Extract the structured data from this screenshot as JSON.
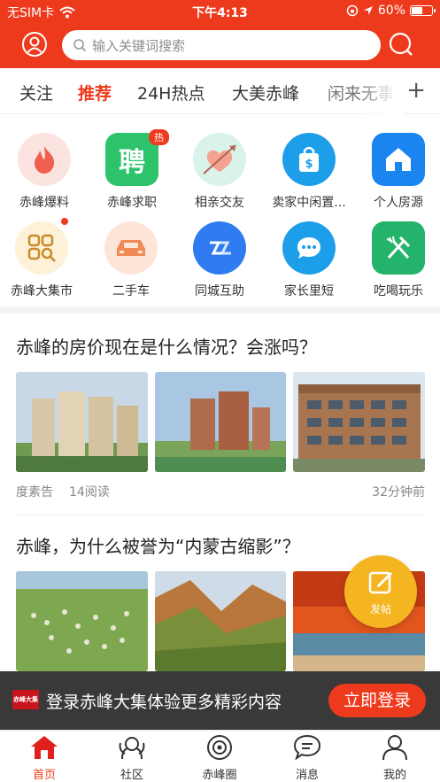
{
  "status_bar": {
    "carrier": "无SIM卡",
    "time": "下午4:13",
    "battery_text": "60%",
    "battery_level": 0.6
  },
  "search": {
    "placeholder": "输入关键词搜索"
  },
  "tabs": [
    {
      "label": "关注"
    },
    {
      "label": "推荐"
    },
    {
      "label": "24H热点"
    },
    {
      "label": "大美赤峰"
    },
    {
      "label": "闲来无事"
    }
  ],
  "tabs_more": "+",
  "grid": {
    "items": [
      {
        "label": "赤峰爆料",
        "icon": "fire-icon",
        "color": "#fbe3e0"
      },
      {
        "label": "赤峰求职",
        "icon": "job-icon",
        "color": "#2cc36b",
        "badge": "热"
      },
      {
        "label": "相亲交友",
        "icon": "heart-arrow-icon",
        "color": "#d9f2ea"
      },
      {
        "label": "卖家中闲置...",
        "icon": "shopping-bag-icon",
        "color": "#1c9ee8"
      },
      {
        "label": "个人房源",
        "icon": "house-icon",
        "color": "#1a84f0"
      },
      {
        "label": "赤峰大集市",
        "icon": "market-icon",
        "color": "#fdf1d7"
      },
      {
        "label": "二手车",
        "icon": "car-icon",
        "color": "#fde5d8"
      },
      {
        "label": "同城互助",
        "icon": "help-icon",
        "color": "#2e7cf0"
      },
      {
        "label": "家长里短",
        "icon": "chat-icon",
        "color": "#1c9ee8"
      },
      {
        "label": "吃喝玩乐",
        "icon": "fork-knife-icon",
        "color": "#24b36a"
      }
    ]
  },
  "articles": [
    {
      "title": "赤峰的房价现在是什么情况？会涨吗？",
      "source": "度素告",
      "reads": "14阅读",
      "time": "32分钟前"
    },
    {
      "title": "赤峰，为什么被誉为“内蒙古缩影”？"
    }
  ],
  "fab": {
    "label": "发帖"
  },
  "login_banner": {
    "logo_text": "赤峰大集",
    "text": "登录赤峰大集体验更多精彩内容",
    "button": "立即登录"
  },
  "bottom_nav": [
    {
      "label": "首页"
    },
    {
      "label": "社区"
    },
    {
      "label": "赤峰圈"
    },
    {
      "label": "消息"
    },
    {
      "label": "我的"
    }
  ],
  "colors": {
    "brand": "#ee3a1c",
    "fab": "#f5b521"
  }
}
